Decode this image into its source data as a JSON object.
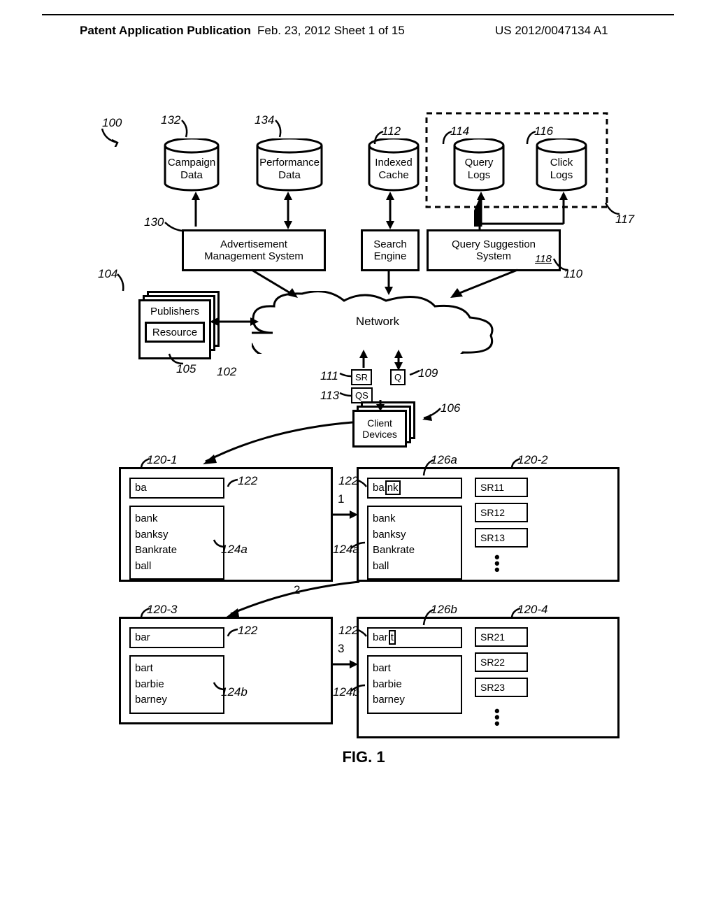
{
  "header": {
    "pub": "Patent Application Publication",
    "date": "Feb. 23, 2012  Sheet 1 of 15",
    "app": "US 2012/0047134 A1"
  },
  "figure_title": "FIG. 1",
  "labels": {
    "l100": "100",
    "l132": "132",
    "l134": "134",
    "l112": "112",
    "l114": "114",
    "l116": "116",
    "l117": "117",
    "l130": "130",
    "l104": "104",
    "l110": "110",
    "l102": "102",
    "l105": "105",
    "l111": "111",
    "l109": "109",
    "l113": "113",
    "l106": "106",
    "l120_1": "120-1",
    "l120_2": "120-2",
    "l120_3": "120-3",
    "l120_4": "120-4",
    "l122_1": "122",
    "l122_2": "122",
    "l122_3": "122",
    "l122_4": "122",
    "l124a_1": "124a",
    "l124a_2": "124a",
    "l124b_1": "124b",
    "l124b_2": "124b",
    "l126a": "126a",
    "l126b": "126b"
  },
  "cyl": {
    "campaign": "Campaign\nData",
    "perf": "Performance\nData",
    "indexed": "Indexed\nCache",
    "query": "Query\nLogs",
    "click": "Click\nLogs"
  },
  "boxes": {
    "ams": "Advertisement\nManagement System",
    "se": "Search\nEngine",
    "qss": "Query Suggestion\nSystem",
    "qss_ref": "118",
    "publishers": "Publishers",
    "resource": "Resource",
    "client": "Client\nDevices",
    "network": "Network"
  },
  "small": {
    "sr": "SR",
    "q": "Q",
    "qs": "QS"
  },
  "step": {
    "s1": "1",
    "s2": "2",
    "s3": "3"
  },
  "panes": {
    "p1": {
      "input": "ba",
      "sugg": [
        "bank",
        "banksy",
        "Bankrate",
        "ball"
      ]
    },
    "p2": {
      "input_prefix": "ba",
      "input_sel": "nk",
      "sugg": [
        "bank",
        "banksy",
        "Bankrate",
        "ball"
      ],
      "sr": [
        "SR11",
        "SR12",
        "SR13"
      ]
    },
    "p3": {
      "input": "bar",
      "sugg": [
        "bart",
        "barbie",
        "barney"
      ]
    },
    "p4": {
      "input_prefix": "bar",
      "input_sel": "t",
      "sugg": [
        "bart",
        "barbie",
        "barney"
      ],
      "sr": [
        "SR21",
        "SR22",
        "SR23"
      ]
    }
  }
}
